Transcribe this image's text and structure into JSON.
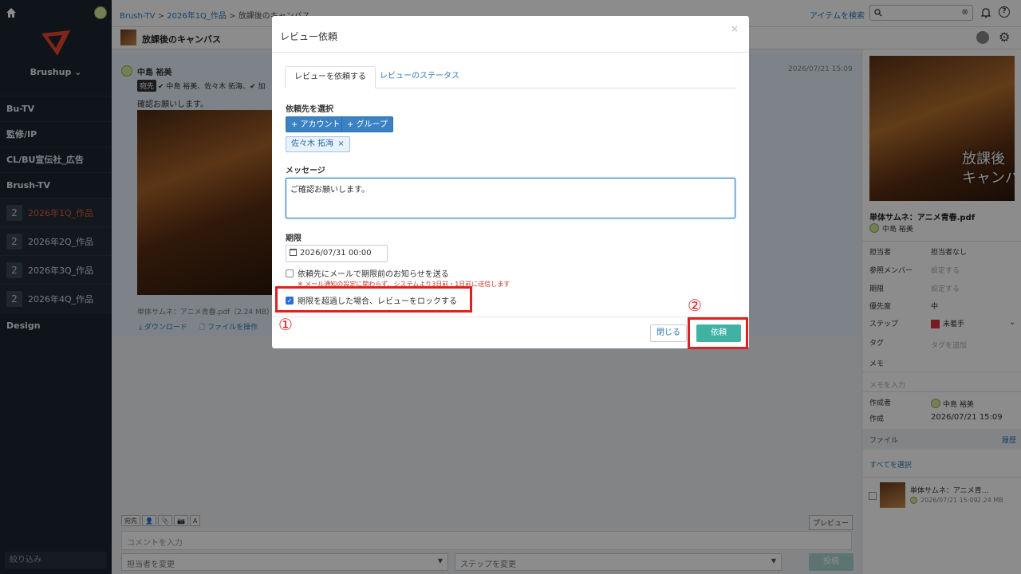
{
  "sidebar": {
    "brand": "Brushup",
    "items": [
      "Bu-TV",
      "監修/IP",
      "CL/BU宣伝社_広告",
      "Brush-TV"
    ],
    "sub_items": [
      {
        "num": "2",
        "label": "2026年1Q_作品"
      },
      {
        "num": "2",
        "label": "2026年2Q_作品"
      },
      {
        "num": "2",
        "label": "2026年3Q_作品"
      },
      {
        "num": "2",
        "label": "2026年4Q_作品"
      }
    ],
    "design": "Design",
    "filter": "絞り込み"
  },
  "topbar": {
    "crumb1": "Brush-TV",
    "sep": " > ",
    "crumb2": "2026年1Q_作品",
    "crumb3": "放課後のキャンバス",
    "item_search": "アイテムを検索"
  },
  "subheader": {
    "title": "放課後のキャンバス"
  },
  "comment": {
    "author": "中島 裕美",
    "date": "2026/07/21 15:09",
    "to": "宛先",
    "recipients": "✔ 中島 裕美、佐々木 拓海、✔ 加",
    "body": "確認お願いします。",
    "filename": "単体サムネ：アニメ青春.pdf（2.24 MB）",
    "download": "ダウンロード",
    "operate": "ファイルを操作"
  },
  "composer": {
    "tools": [
      "宛先",
      "👤",
      "📎",
      "📷",
      "A"
    ],
    "preview": "プレビュー",
    "placeholder": "コメントを入力",
    "assignee": "担当者を変更",
    "step": "ステップを変更",
    "post": "投稿"
  },
  "right_panel": {
    "thumb_text1": "放課後",
    "thumb_text2": "キャンバ",
    "file_name": "単体サムネ：アニメ青春.pdf",
    "user": "中島 裕美",
    "rows": {
      "assignee_label": "担当者",
      "assignee_val": "担当者なし",
      "members_label": "参照メンバー",
      "members_val": "設定する",
      "deadline_label": "期限",
      "deadline_val": "設定する",
      "priority_label": "優先度",
      "priority_val": "中",
      "step_label": "ステップ",
      "step_val": "未着手",
      "tag_label": "タグ",
      "tag_val": "タグを追加",
      "memo_label": "メモ",
      "memo_val": "メモを入力",
      "creator_label": "作成者",
      "creator_val": "中島 裕美",
      "created_label": "作成",
      "created_val": "2026/07/21 15:09"
    },
    "files_label": "ファイル",
    "history": "履歴",
    "select_all": "すべてを選択",
    "file_row": {
      "name": "単体サムネ：アニメ青…",
      "date": "2026/07/21 15:09",
      "size": "2.24 MB"
    },
    "step_color": "#d9343f"
  },
  "modal": {
    "title": "レビュー依頼",
    "close_x": "×",
    "tabs": [
      "レビューを依頼する",
      "レビューのステータス"
    ],
    "select_label": "依頼先を選択",
    "add_account": "+ アカウント",
    "add_group": "+ グループ",
    "chip": "佐々木 拓海",
    "chip_x": "×",
    "message_label": "メッセージ",
    "message_value": "ご確認お願いします。",
    "deadline_label": "期限",
    "deadline_value": "2026/07/31 00:00",
    "email_option": "依頼先にメールで期限前のお知らせを送る",
    "email_note": "※ メール通知の設定に関わらず、システムより3日前・1日前に送信します",
    "lock_option": "期限を超過した場合、レビューをロックする",
    "close_button": "閉じる",
    "request_button": "依頼"
  },
  "annotations": {
    "step1": "①",
    "step2": "②",
    "color": "#e02020"
  }
}
